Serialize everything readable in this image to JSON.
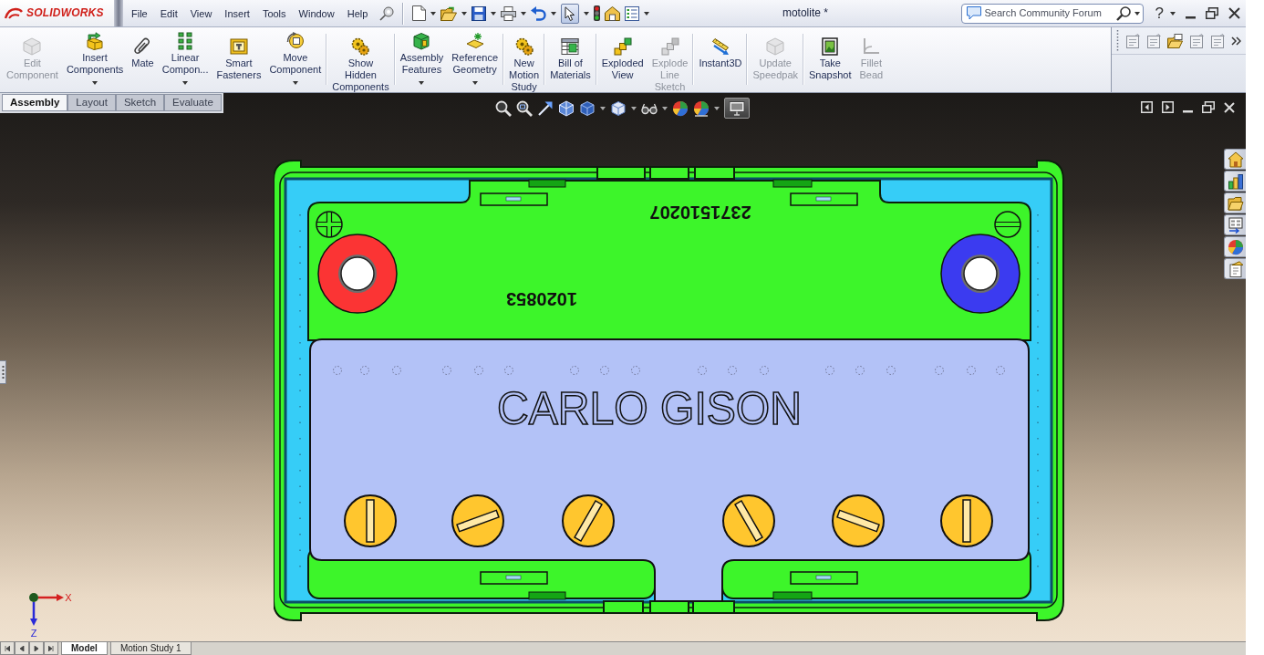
{
  "app": {
    "logo": "SOLIDWORKS",
    "menu": [
      "File",
      "Edit",
      "View",
      "Insert",
      "Tools",
      "Window",
      "Help"
    ],
    "document_title": "motolite *",
    "search": {
      "placeholder": "Search Community Forum"
    },
    "help": "?"
  },
  "quick_access": {
    "select_tool_selected": true
  },
  "command_manager": {
    "groups": [
      [
        {
          "lines": [
            "Edit",
            "Component"
          ],
          "disabled": true,
          "dropdown": false
        },
        {
          "lines": [
            "Insert",
            "Components"
          ],
          "disabled": false,
          "dropdown": true
        },
        {
          "lines": [
            "Mate"
          ],
          "disabled": false,
          "dropdown": false
        },
        {
          "lines": [
            "Linear",
            "Compon..."
          ],
          "disabled": false,
          "dropdown": true
        },
        {
          "lines": [
            "Smart",
            "Fasteners"
          ],
          "disabled": false,
          "dropdown": false
        },
        {
          "lines": [
            "Move",
            "Component"
          ],
          "disabled": false,
          "dropdown": true
        }
      ],
      [
        {
          "lines": [
            "Show",
            "Hidden",
            "Components"
          ],
          "disabled": false,
          "dropdown": false
        }
      ],
      [
        {
          "lines": [
            "Assembly",
            "Features"
          ],
          "disabled": false,
          "dropdown": true
        },
        {
          "lines": [
            "Reference",
            "Geometry"
          ],
          "disabled": false,
          "dropdown": true
        }
      ],
      [
        {
          "lines": [
            "New",
            "Motion",
            "Study"
          ],
          "disabled": false,
          "dropdown": false
        }
      ],
      [
        {
          "lines": [
            "Bill of",
            "Materials"
          ],
          "disabled": false,
          "dropdown": false
        }
      ],
      [
        {
          "lines": [
            "Exploded",
            "View"
          ],
          "disabled": false,
          "dropdown": false
        },
        {
          "lines": [
            "Explode",
            "Line",
            "Sketch"
          ],
          "disabled": true,
          "dropdown": false
        }
      ],
      [
        {
          "lines": [
            "Instant3D"
          ],
          "disabled": false,
          "dropdown": false
        }
      ],
      [
        {
          "lines": [
            "Update",
            "Speedpak"
          ],
          "disabled": true,
          "dropdown": false
        }
      ],
      [
        {
          "lines": [
            "Take",
            "Snapshot"
          ],
          "disabled": false,
          "dropdown": false
        },
        {
          "lines": [
            "Fillet",
            "Bead"
          ],
          "disabled": true,
          "dropdown": false
        }
      ]
    ]
  },
  "command_tabs": [
    {
      "label": "Assembly",
      "selected": true
    },
    {
      "label": "Layout",
      "selected": false
    },
    {
      "label": "Sketch",
      "selected": false
    },
    {
      "label": "Evaluate",
      "selected": false
    }
  ],
  "view_toolbar": {
    "last_tool_selected": true
  },
  "model": {
    "labels": [
      {
        "kind": "stamp",
        "text": "2371510207"
      },
      {
        "kind": "stamp",
        "text": "1020853"
      },
      {
        "kind": "brand",
        "text": "CARLO GISON"
      }
    ]
  },
  "triad": {
    "axes": [
      "X",
      "Z"
    ]
  },
  "bottom_tabs": [
    {
      "label": "Model",
      "selected": true
    },
    {
      "label": "Motion Study 1",
      "selected": false
    }
  ]
}
